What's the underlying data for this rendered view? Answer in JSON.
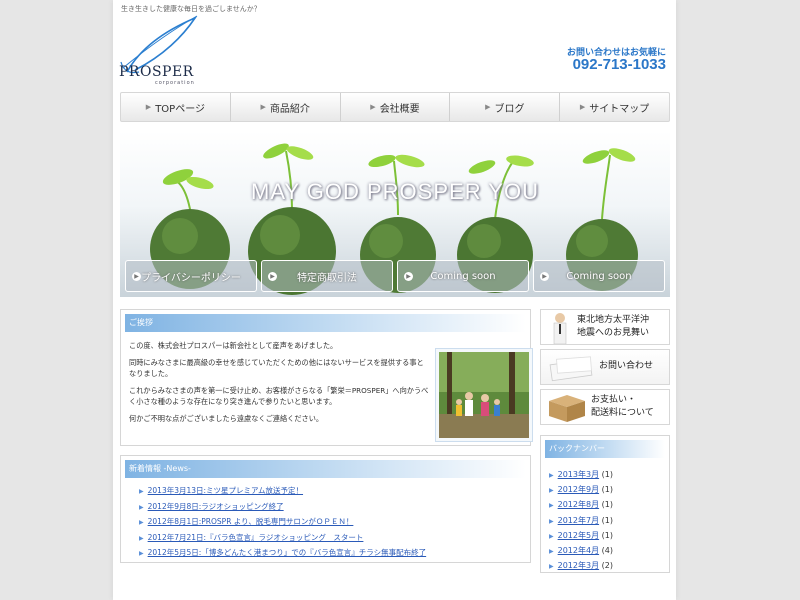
{
  "header": {
    "tagline": "生き生きした健康な毎日を過ごしませんか？",
    "logo_text": "PROSPER",
    "logo_sub": "corporation",
    "contact_label": "お問い合わせはお気軽に",
    "phone": "092-713-1033"
  },
  "nav": [
    {
      "label": "TOPページ"
    },
    {
      "label": "商品紹介"
    },
    {
      "label": "会社概要"
    },
    {
      "label": "ブログ"
    },
    {
      "label": "サイトマップ"
    }
  ],
  "hero": {
    "title": "MAY GOD PROSPER YOU",
    "buttons": [
      {
        "label": "プライバシーポリシー"
      },
      {
        "label": "特定商取引法"
      },
      {
        "label": "Coming soon"
      },
      {
        "label": "Coming soon"
      }
    ]
  },
  "greeting": {
    "heading": "ご挨拶",
    "p1": "この度、株式会社プロスパーは新会社として産声をあげました。",
    "p2": "同時にみなさまに最高級の幸せを感じていただくための他にはないサービスを提供する事となりました。",
    "p3": "これからみなさまの声を第一に受け止め、お客様がさらなる「繁栄＝PROSPER」へ向かうべく小さな種のような存在になり突き進んで参りたいと思います。",
    "p4": "何かご不明な点がございましたら遠慮なくご連絡ください。"
  },
  "news": {
    "heading": "新着情報 -News-",
    "items": [
      "2013年3月13日:ミツ星プレミアム放送予定！",
      "2012年9月8日:ラジオショッピング終了",
      "2012年8月1日:PROSPR より、脱毛専門サロンがＯＰＥＮ！",
      "2012年7月21日:『バラ色宣言』ラジオショッピング　スタート",
      "2012年5月5日:「博多どんたく港まつり」での『バラ色宣言』チラシ無事配布終了"
    ]
  },
  "sidebar": {
    "banner1_line1": "東北地方太平洋沖",
    "banner1_line2": "地震へのお見舞い",
    "banner2": "お問い合わせ",
    "banner3_line1": "お支払い・",
    "banner3_line2": "配送料について",
    "archive_heading": "バックナンバー",
    "archive": [
      {
        "month": "2013年3月",
        "count": "(1)"
      },
      {
        "month": "2012年9月",
        "count": "(1)"
      },
      {
        "month": "2012年8月",
        "count": "(1)"
      },
      {
        "month": "2012年7月",
        "count": "(1)"
      },
      {
        "month": "2012年5月",
        "count": "(1)"
      },
      {
        "month": "2012年4月",
        "count": "(4)"
      },
      {
        "month": "2012年3月",
        "count": "(2)"
      }
    ]
  },
  "colors": {
    "accent": "#2b77c8",
    "link": "#2a5ab8",
    "moss": "#4f7a35",
    "sprout": "#8fd13c"
  }
}
